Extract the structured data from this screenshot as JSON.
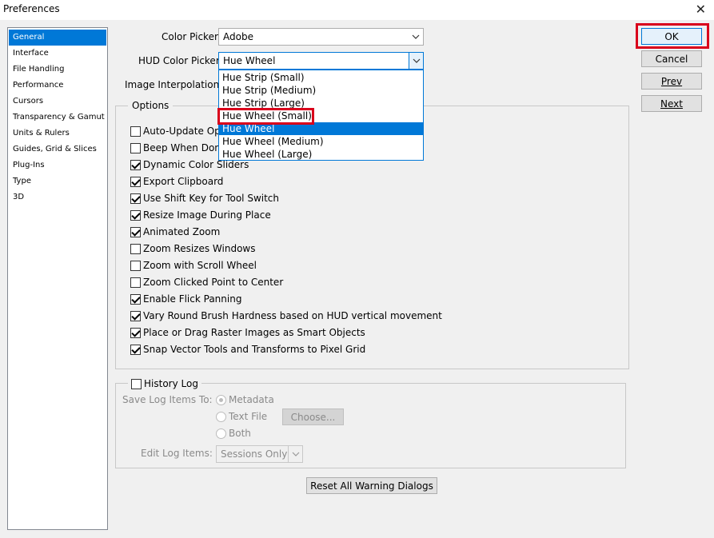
{
  "window": {
    "title": "Preferences",
    "close_glyph": "✕"
  },
  "sidebar": {
    "items": [
      {
        "label": "General",
        "selected": true
      },
      {
        "label": "Interface"
      },
      {
        "label": "File Handling"
      },
      {
        "label": "Performance"
      },
      {
        "label": "Cursors"
      },
      {
        "label": "Transparency & Gamut"
      },
      {
        "label": "Units & Rulers"
      },
      {
        "label": "Guides, Grid & Slices"
      },
      {
        "label": "Plug-Ins"
      },
      {
        "label": "Type"
      },
      {
        "label": "3D"
      }
    ]
  },
  "general": {
    "color_picker_label": "Color Picker:",
    "color_picker_value": "Adobe",
    "hud_label": "HUD Color Picker:",
    "hud_value": "Hue Wheel",
    "interp_label": "Image Interpolation:"
  },
  "hud_dropdown": {
    "options": [
      "Hue Strip (Small)",
      "Hue Strip (Medium)",
      "Hue Strip (Large)",
      "Hue Wheel (Small)",
      "Hue Wheel",
      "Hue Wheel (Medium)",
      "Hue Wheel (Large)"
    ],
    "selected": "Hue Wheel",
    "highlighted_option": "Hue Wheel (Small)"
  },
  "options": {
    "legend": "Options",
    "checkboxes": [
      {
        "label": "Auto-Update Ope",
        "checked": false
      },
      {
        "label": "Beep When Done",
        "checked": false
      },
      {
        "label": "Dynamic Color Sliders",
        "checked": true
      },
      {
        "label": "Export Clipboard",
        "checked": true
      },
      {
        "label": "Use Shift Key for Tool Switch",
        "checked": true
      },
      {
        "label": "Resize Image During Place",
        "checked": true
      },
      {
        "label": "Animated Zoom",
        "checked": true
      },
      {
        "label": "Zoom Resizes Windows",
        "checked": false
      },
      {
        "label": "Zoom with Scroll Wheel",
        "checked": false
      },
      {
        "label": "Zoom Clicked Point to Center",
        "checked": false
      },
      {
        "label": "Enable Flick Panning",
        "checked": true
      },
      {
        "label": "Vary Round Brush Hardness based on HUD vertical movement",
        "checked": true
      },
      {
        "label": "Place or Drag Raster Images as Smart Objects",
        "checked": true
      },
      {
        "label": "Snap Vector Tools and Transforms to Pixel Grid",
        "checked": true
      }
    ]
  },
  "history": {
    "legend": "History Log",
    "checked": false,
    "save_to_label": "Save Log Items To:",
    "radios": [
      {
        "label": "Metadata",
        "checked": true
      },
      {
        "label": "Text File",
        "checked": false
      },
      {
        "label": "Both",
        "checked": false
      }
    ],
    "choose_label": "Choose...",
    "edit_label": "Edit Log Items:",
    "edit_value": "Sessions Only"
  },
  "reset_label": "Reset All Warning Dialogs",
  "buttons": {
    "ok": "OK",
    "cancel": "Cancel",
    "prev": "Prev",
    "next": "Next"
  },
  "colors": {
    "accent": "#0078d7",
    "highlight_box": "#d9001b",
    "background": "#f0f0f0"
  },
  "icons": {
    "close": "close-icon",
    "chevron": "chevron-down-icon",
    "checkmark": "checkmark-icon",
    "radio": "radio-dot-icon"
  }
}
